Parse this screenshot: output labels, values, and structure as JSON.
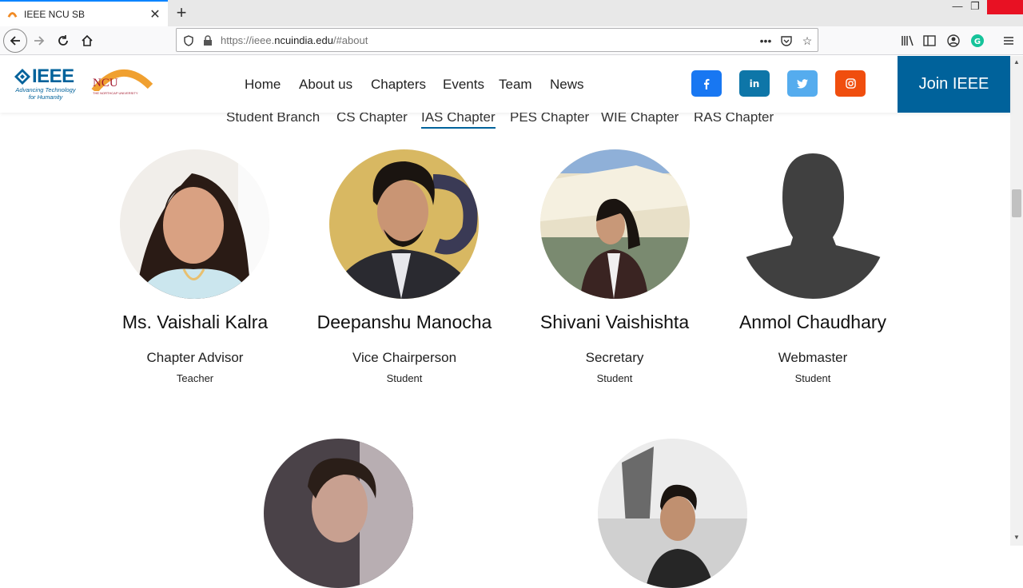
{
  "browser": {
    "tab_title": "IEEE NCU SB",
    "new_tab": "+",
    "url_prefix": "https://ieee.",
    "url_domain": "ncuindia.edu",
    "url_suffix": "/#about"
  },
  "header": {
    "logo_ieee": "IEEE",
    "logo_ieee_tagline": "Advancing Technology for Humanity",
    "logo_ncu": "NCU",
    "logo_ncu_sub": "THE NORTHCAP UNIVERSITY",
    "nav": [
      "Home",
      "About us",
      "Chapters",
      "Events",
      "Team",
      "News"
    ],
    "social": [
      {
        "label": "f",
        "color": "#1877f2",
        "icon": "facebook-icon"
      },
      {
        "label": "in",
        "color": "#0e76a8",
        "icon": "linkedin-icon"
      },
      {
        "label": "t",
        "color": "#55acee",
        "icon": "twitter-icon"
      },
      {
        "label": "o",
        "color": "#f04e0e",
        "icon": "instagram-icon"
      }
    ],
    "join_label": "Join IEEE"
  },
  "chapter_tabs": [
    {
      "label": "Student Branch"
    },
    {
      "label": "CS Chapter"
    },
    {
      "label": "IAS Chapter",
      "active": true
    },
    {
      "label": "PES Chapter"
    },
    {
      "label": "WIE Chapter"
    },
    {
      "label": "RAS Chapter"
    }
  ],
  "members": [
    {
      "name": "Ms. Vaishali Kalra",
      "role": "Chapter Advisor",
      "type": "Teacher"
    },
    {
      "name": "Deepanshu Manocha",
      "role": "Vice Chairperson",
      "type": "Student"
    },
    {
      "name": "Shivani Vaishishta",
      "role": "Secretary",
      "type": "Student"
    },
    {
      "name": "Anmol Chaudhary",
      "role": "Webmaster",
      "type": "Student"
    }
  ],
  "colors": {
    "ieee_blue": "#00629b",
    "active_tab": "#0a84ff"
  }
}
